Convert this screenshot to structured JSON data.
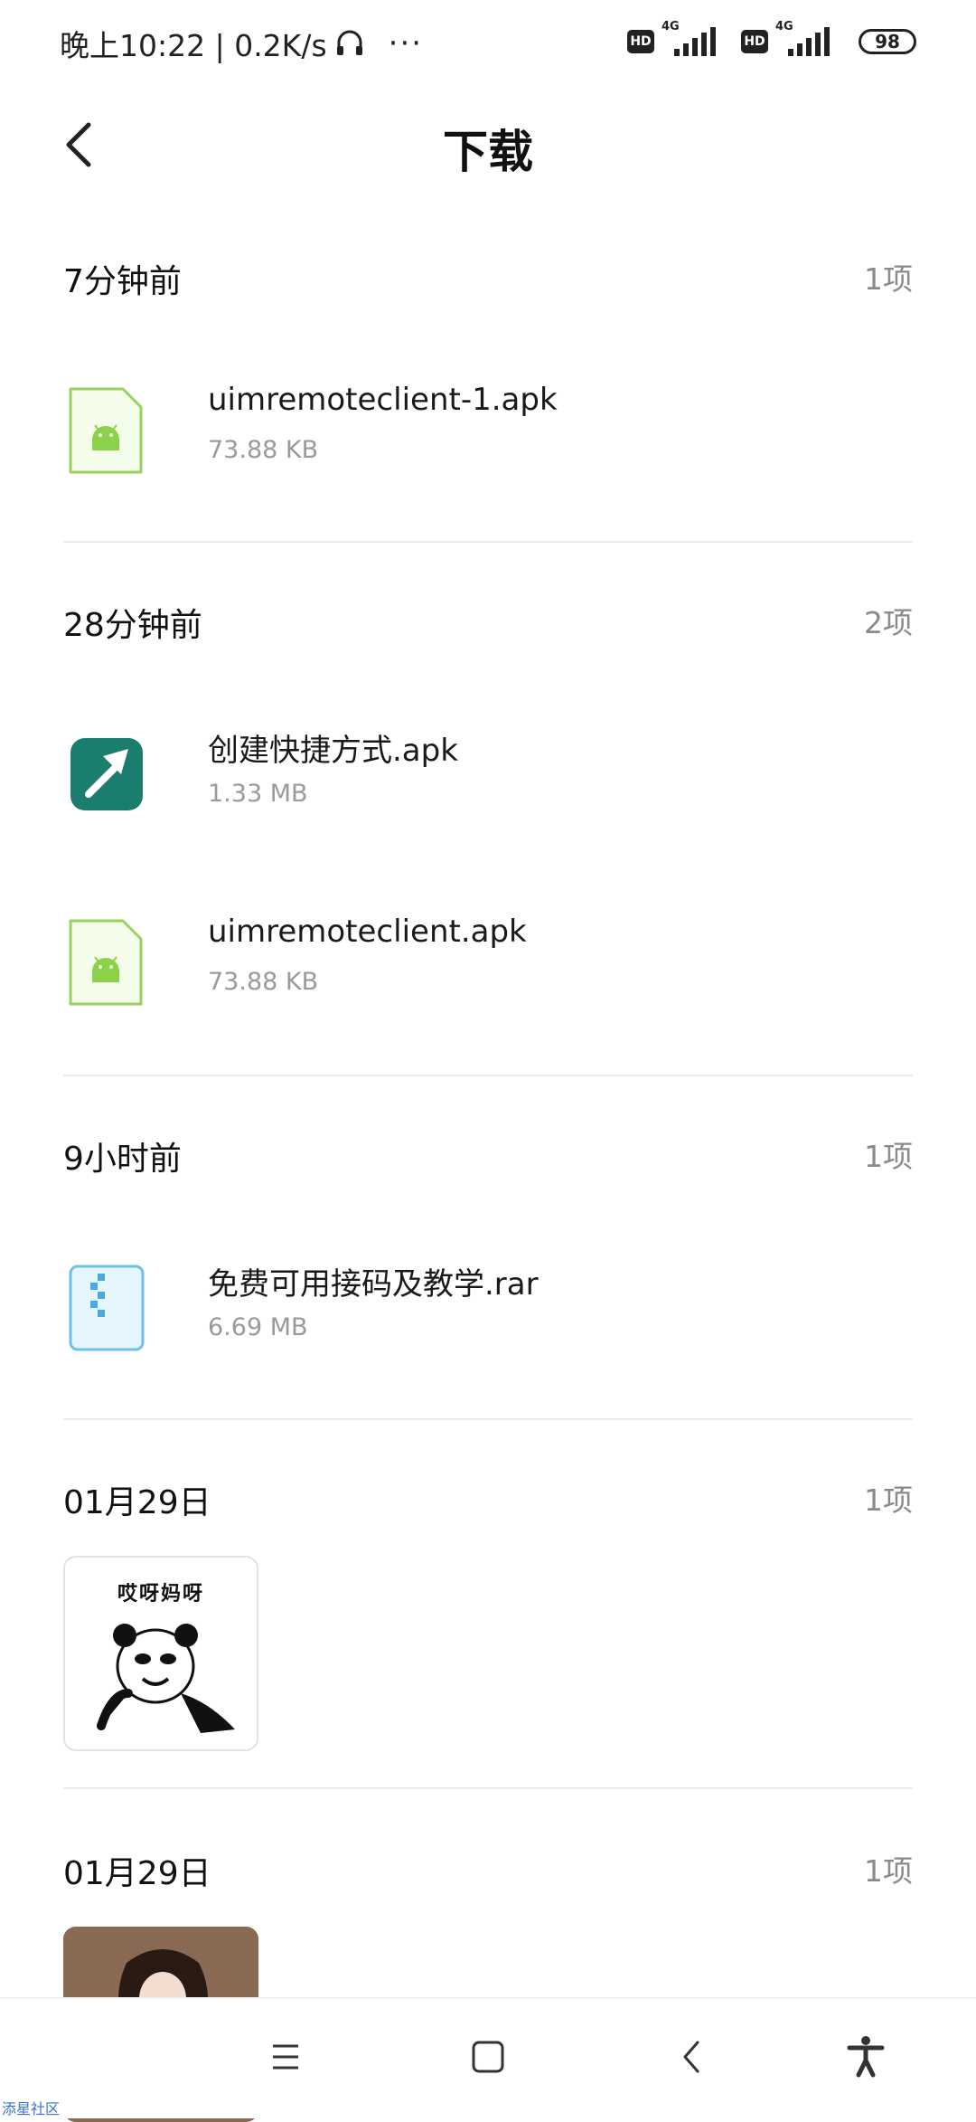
{
  "status_bar": {
    "time_speed": "晚上10:22 | 0.2K/s",
    "dots": "···",
    "hd": "HD",
    "network1": "4G",
    "network2": "4G",
    "battery": "98"
  },
  "header": {
    "title": "下载"
  },
  "sections": [
    {
      "title": "7分钟前",
      "count": "1项",
      "files": [
        {
          "name": "uimremoteclient-1.apk",
          "size": "73.88 KB",
          "icon": "android-apk-icon"
        }
      ]
    },
    {
      "title": "28分钟前",
      "count": "2项",
      "files": [
        {
          "name": "创建快捷方式.apk",
          "size": "1.33 MB",
          "icon": "shortcut-app-icon"
        },
        {
          "name": "uimremoteclient.apk",
          "size": "73.88 KB",
          "icon": "android-apk-icon"
        }
      ]
    },
    {
      "title": "9小时前",
      "count": "1项",
      "files": [
        {
          "name": "免费可用接码及教学.rar",
          "size": "6.69 MB",
          "icon": "archive-icon"
        }
      ]
    },
    {
      "title": "01月29日",
      "count": "1项",
      "thumb_caption": "哎呀妈呀"
    },
    {
      "title": "01月29日",
      "count": "1项"
    }
  ],
  "watermark": "添星社区"
}
